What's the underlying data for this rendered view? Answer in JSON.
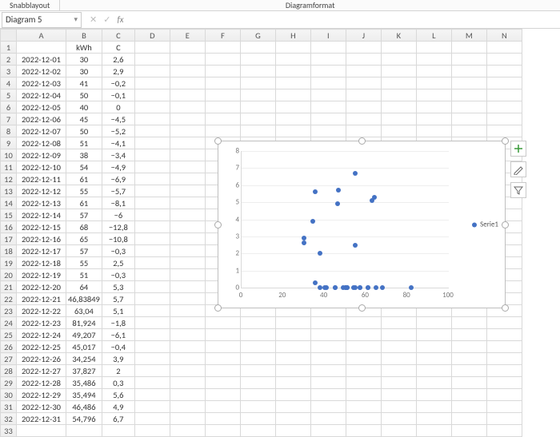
{
  "ribbon": {
    "tab_left": "Snabblayout",
    "tab_center": "Diagramformat"
  },
  "namebox": {
    "value": "Diagram 5",
    "dropdown_glyph": "▾"
  },
  "fx": {
    "cancel_glyph": "✕",
    "accept_glyph": "✓",
    "label": "fx",
    "value": ""
  },
  "columns": [
    "A",
    "B",
    "C",
    "D",
    "E",
    "F",
    "G",
    "H",
    "I",
    "J",
    "K",
    "L",
    "M",
    "N"
  ],
  "header_row": {
    "A": "",
    "B": "kWh",
    "C": "C"
  },
  "rows": [
    {
      "r": 2,
      "A": "2022-12-01",
      "B": "30",
      "C": "2,6"
    },
    {
      "r": 3,
      "A": "2022-12-02",
      "B": "30",
      "C": "2,9"
    },
    {
      "r": 4,
      "A": "2022-12-03",
      "B": "41",
      "C": "−0,2"
    },
    {
      "r": 5,
      "A": "2022-12-04",
      "B": "50",
      "C": "−0,1"
    },
    {
      "r": 6,
      "A": "2022-12-05",
      "B": "40",
      "C": "0"
    },
    {
      "r": 7,
      "A": "2022-12-06",
      "B": "45",
      "C": "−4,5"
    },
    {
      "r": 8,
      "A": "2022-12-07",
      "B": "50",
      "C": "−5,2"
    },
    {
      "r": 9,
      "A": "2022-12-08",
      "B": "51",
      "C": "−4,1"
    },
    {
      "r": 10,
      "A": "2022-12-09",
      "B": "38",
      "C": "−3,4"
    },
    {
      "r": 11,
      "A": "2022-12-10",
      "B": "54",
      "C": "−4,9"
    },
    {
      "r": 12,
      "A": "2022-12-11",
      "B": "61",
      "C": "−6,9"
    },
    {
      "r": 13,
      "A": "2022-12-12",
      "B": "55",
      "C": "−5,7"
    },
    {
      "r": 14,
      "A": "2022-12-13",
      "B": "61",
      "C": "−8,1"
    },
    {
      "r": 15,
      "A": "2022-12-14",
      "B": "57",
      "C": "−6"
    },
    {
      "r": 16,
      "A": "2022-12-15",
      "B": "68",
      "C": "−12,8"
    },
    {
      "r": 17,
      "A": "2022-12-16",
      "B": "65",
      "C": "−10,8"
    },
    {
      "r": 18,
      "A": "2022-12-17",
      "B": "57",
      "C": "−0,3"
    },
    {
      "r": 19,
      "A": "2022-12-18",
      "B": "55",
      "C": "2,5"
    },
    {
      "r": 20,
      "A": "2022-12-19",
      "B": "51",
      "C": "−0,3"
    },
    {
      "r": 21,
      "A": "2022-12-20",
      "B": "64",
      "C": "5,3"
    },
    {
      "r": 22,
      "A": "2022-12-21",
      "B": "46,83849",
      "C": "5,7"
    },
    {
      "r": 23,
      "A": "2022-12-22",
      "B": "63,04",
      "C": "5,1"
    },
    {
      "r": 24,
      "A": "2022-12-23",
      "B": "81,924",
      "C": "−1,8"
    },
    {
      "r": 25,
      "A": "2022-12-24",
      "B": "49,207",
      "C": "−6,1"
    },
    {
      "r": 26,
      "A": "2022-12-25",
      "B": "45,017",
      "C": "−0,4"
    },
    {
      "r": 27,
      "A": "2022-12-26",
      "B": "34,254",
      "C": "3,9"
    },
    {
      "r": 28,
      "A": "2022-12-27",
      "B": "37,827",
      "C": "2"
    },
    {
      "r": 29,
      "A": "2022-12-28",
      "B": "35,486",
      "C": "0,3"
    },
    {
      "r": 30,
      "A": "2022-12-29",
      "B": "35,494",
      "C": "5,6"
    },
    {
      "r": 31,
      "A": "2022-12-30",
      "B": "46,486",
      "C": "4,9"
    },
    {
      "r": 32,
      "A": "2022-12-31",
      "B": "54,796",
      "C": "6,7"
    }
  ],
  "empty_row": 33,
  "chart_legend": "Serie1",
  "chart_side_buttons": {
    "elements": "+",
    "style": "brush",
    "filter": "filter"
  },
  "chart_data": {
    "type": "scatter",
    "legend": [
      "Serie1"
    ],
    "xlabel": "",
    "ylabel": "",
    "xlim": [
      0,
      100
    ],
    "ylim": [
      0,
      8
    ],
    "xticks": [
      0,
      20,
      40,
      60,
      80,
      100
    ],
    "yticks": [
      0,
      1,
      2,
      3,
      4,
      5,
      6,
      7,
      8
    ],
    "series": [
      {
        "name": "Serie1",
        "points": [
          [
            30,
            2.6
          ],
          [
            30,
            2.9
          ],
          [
            41,
            0
          ],
          [
            50,
            0
          ],
          [
            40,
            0
          ],
          [
            45,
            0
          ],
          [
            50,
            0
          ],
          [
            51,
            0
          ],
          [
            38,
            0
          ],
          [
            54,
            0
          ],
          [
            61,
            0
          ],
          [
            55,
            0
          ],
          [
            61,
            0
          ],
          [
            57,
            0
          ],
          [
            68,
            0
          ],
          [
            65,
            0
          ],
          [
            57,
            0
          ],
          [
            55,
            2.5
          ],
          [
            51,
            0
          ],
          [
            64,
            5.3
          ],
          [
            46.8,
            5.7
          ],
          [
            63.0,
            5.1
          ],
          [
            81.9,
            0
          ],
          [
            49.2,
            0
          ],
          [
            45.0,
            0
          ],
          [
            34.3,
            3.9
          ],
          [
            37.8,
            2.0
          ],
          [
            35.5,
            0.3
          ],
          [
            35.5,
            5.6
          ],
          [
            46.5,
            4.9
          ],
          [
            54.8,
            6.7
          ]
        ]
      }
    ]
  }
}
